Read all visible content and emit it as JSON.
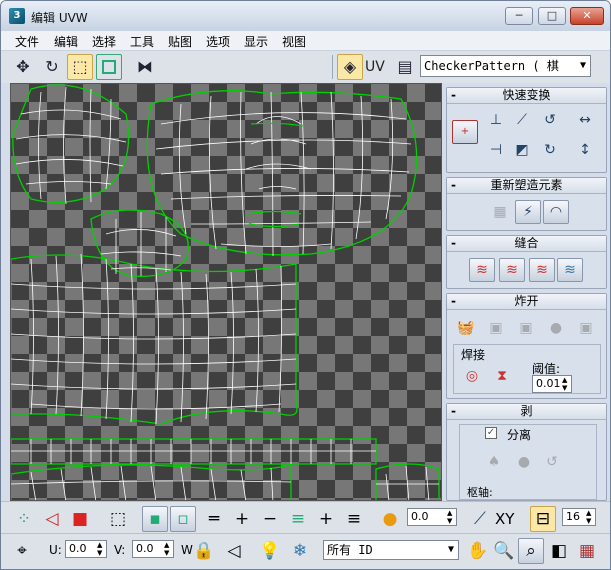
{
  "window": {
    "title": "编辑 UVW",
    "icon_letter": "3",
    "minimize": "─",
    "maximize": "□",
    "close": "✕"
  },
  "menu": [
    "文件",
    "编辑",
    "选择",
    "工具",
    "贴图",
    "选项",
    "显示",
    "视图"
  ],
  "toolbar": {
    "uv_label": "UV",
    "texture_select": "CheckerPattern  ( 棋",
    "icons": [
      "move-icon",
      "rotate-icon",
      "scale-icon",
      "freeform-icon",
      "mirror-icon",
      "texture-icon",
      "properties-icon"
    ]
  },
  "panels": {
    "quick_transform": {
      "title": "快速变换",
      "collapse": "-"
    },
    "reshape": {
      "title": "重新塑造元素",
      "collapse": "-"
    },
    "stitch": {
      "title": "缝合",
      "collapse": "-"
    },
    "explode": {
      "title": "炸开",
      "collapse": "-",
      "weld_label": "焊接",
      "threshold_label": "阈值:",
      "threshold_value": "0.01"
    },
    "peel": {
      "title": "剥",
      "collapse": "-",
      "detach_label": "分离",
      "detach_checked": true,
      "pivot_label": "枢轴:"
    }
  },
  "bottom1": {
    "value_field": "0.0",
    "xy_label": "XY",
    "grid_value": "16"
  },
  "bottom2": {
    "u_label": "U:",
    "u_value": "0.0",
    "v_label": "V:",
    "v_value": "0.0",
    "w_label": "W",
    "filter_select": "所有 ID"
  },
  "colors": {
    "mesh_wire": "#ffffff",
    "mesh_border": "#00cc00",
    "checker_dark": "#3f3f3f",
    "checker_light": "#777777",
    "accent_active": "#fbe7a6"
  }
}
